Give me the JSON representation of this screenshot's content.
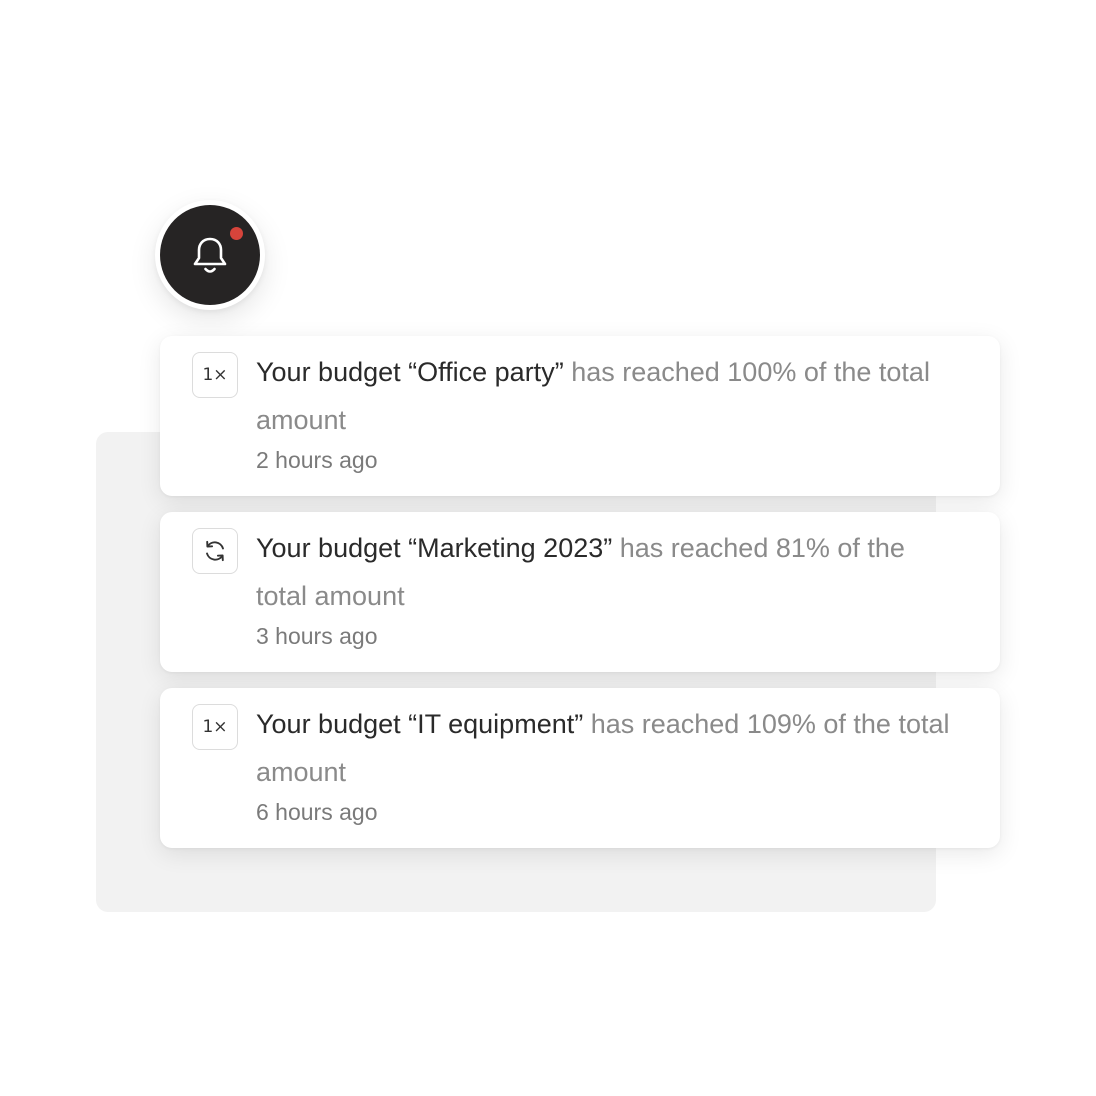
{
  "header": {
    "bell_icon": "bell-icon",
    "has_unread": true,
    "unread_dot_color": "#d6443b"
  },
  "notifications": [
    {
      "type_icon": "one-time-icon",
      "type_label": "1×",
      "title": "Your budget “Office party”",
      "detail": " has reached 100% of the total amount",
      "time": "2 hours ago"
    },
    {
      "type_icon": "recurring-icon",
      "type_label": "",
      "title": "Your budget “Marketing 2023”",
      "detail": " has reached 81% of the total amount",
      "time": "3 hours ago"
    },
    {
      "type_icon": "one-time-icon",
      "type_label": "1×",
      "title": "Your budget “IT equipment”",
      "detail": " has reached 109% of the total amount",
      "time": "6 hours ago"
    }
  ]
}
